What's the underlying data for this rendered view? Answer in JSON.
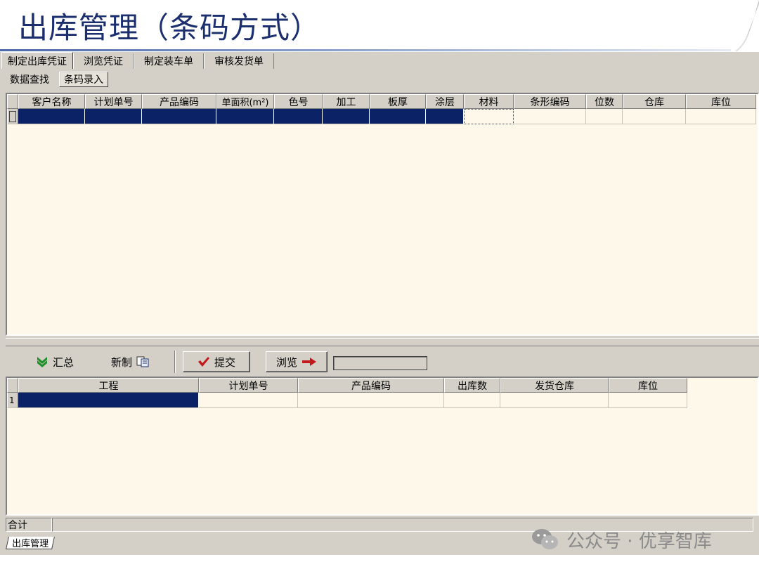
{
  "slide": {
    "title": "出库管理（条码方式）"
  },
  "app": {
    "tabs": [
      "制定出库凭证",
      "浏览凭证",
      "制定装车单",
      "审核发货单"
    ],
    "active_tab": 0,
    "subtabs": [
      "数据查找",
      "条码录入"
    ],
    "active_subtab": 1,
    "top_grid": {
      "columns": [
        "客户名称",
        "计划单号",
        "产品编码",
        "单面积(m²)",
        "色号",
        "加工",
        "板厚",
        "涂层",
        "材料",
        "条形编码",
        "位数",
        "仓库",
        "库位"
      ],
      "rows": [
        [
          "",
          "",
          "",
          "",
          "",
          "",
          "",
          "",
          "",
          "",
          "",
          "",
          ""
        ]
      ]
    },
    "toolbar": {
      "summary_label": "汇总",
      "new_label": "新制",
      "submit_label": "提交",
      "browse_label": "浏览"
    },
    "bottom_grid": {
      "columns": [
        "工程",
        "计划单号",
        "产品编码",
        "出库数",
        "发货仓库",
        "库位"
      ],
      "rows": [
        {
          "num": "1",
          "cells": [
            "",
            "",
            "",
            "",
            "",
            ""
          ]
        }
      ]
    },
    "status": {
      "total_label": "合计"
    },
    "bottom_tab": "出库管理"
  },
  "watermark": {
    "text": "公众号 · 优享智库",
    "icon": "wechat-icon"
  }
}
